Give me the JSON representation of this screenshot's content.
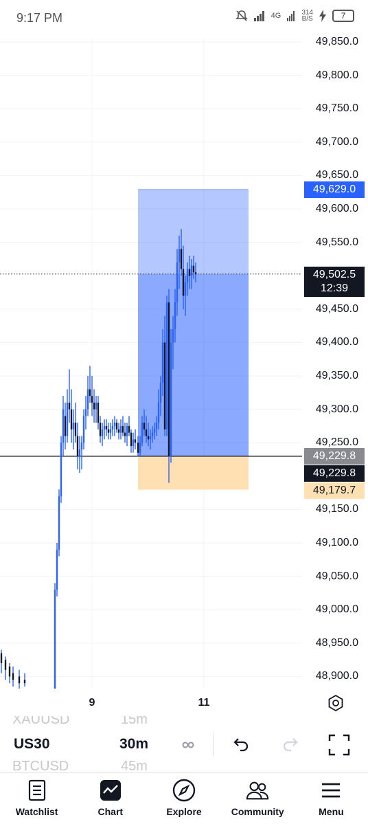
{
  "status_bar": {
    "time": "9:17 PM",
    "network": "4G",
    "speed_value": "314",
    "speed_unit": "B/S",
    "battery": "7"
  },
  "chart": {
    "price_labels": [
      "49,850.0",
      "49,800.0",
      "49,750.0",
      "49,700.0",
      "49,650.0",
      "49,600.0",
      "49,550.0",
      "49,450.0",
      "49,400.0",
      "49,350.0",
      "49,300.0",
      "49,250.0",
      "49,150.0",
      "49,100.0",
      "49,050.0",
      "49,000.0",
      "48,950.0",
      "48,900.0"
    ],
    "target_price": "49,629.0",
    "current_price": "49,502.5",
    "countdown": "12:39",
    "entry_price_grey": "49,229.8",
    "entry_price_black": "49,229.8",
    "stop_price": "49,179.7",
    "time_labels": [
      "9",
      "11"
    ],
    "colors": {
      "candle": "#131722",
      "wick_blue": "#2962ff",
      "profit_zone": "#2962ff",
      "loss_zone": "#ffe0b2",
      "accent": "#2962ff"
    }
  },
  "toolbar": {
    "ghost_symbol_above": "XAUUSD",
    "ghost_interval_above": "15m",
    "symbol": "US30",
    "interval": "30m",
    "ghost_symbol_below": "BTCUSD",
    "ghost_interval_below": "45m"
  },
  "nav": [
    {
      "label": "Watchlist",
      "icon": "watchlist-icon"
    },
    {
      "label": "Chart",
      "icon": "chart-icon"
    },
    {
      "label": "Explore",
      "icon": "compass-icon"
    },
    {
      "label": "Community",
      "icon": "people-icon"
    },
    {
      "label": "Menu",
      "icon": "hamburger-icon"
    }
  ]
}
